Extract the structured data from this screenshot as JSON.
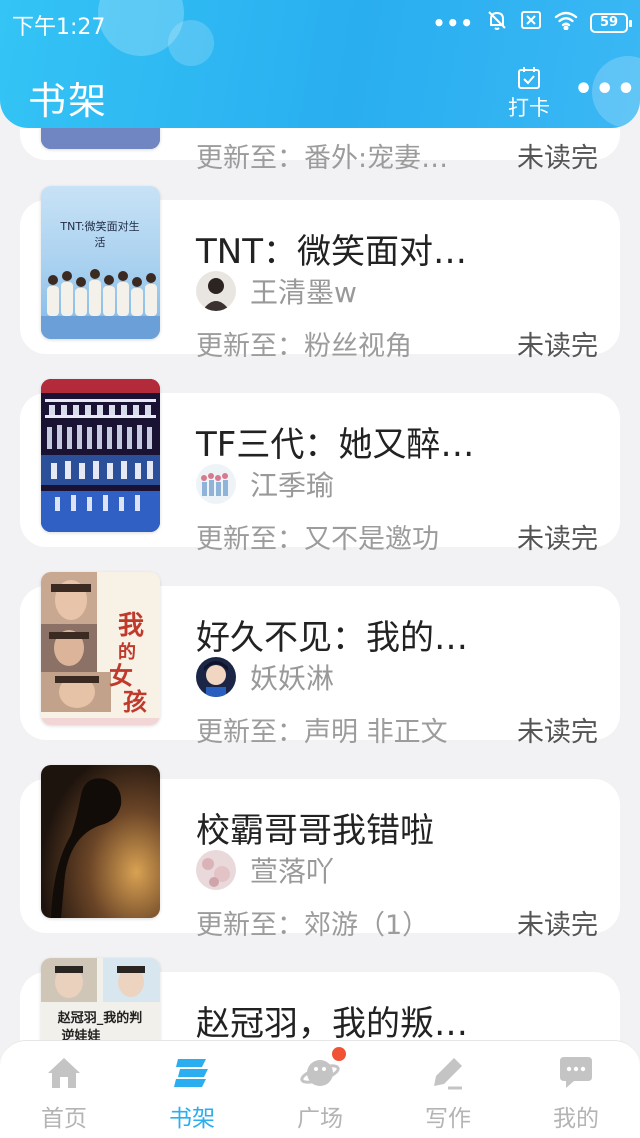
{
  "status_bar": {
    "time": "下午1:27",
    "more_dots": "•••",
    "battery": "59"
  },
  "header": {
    "title": "书架",
    "checkin_label": "打卡",
    "more_label": "•••"
  },
  "books": [
    {
      "title": "",
      "author": "",
      "update": "更新至：番外:宠妻…",
      "status": "未读完"
    },
    {
      "title": "TNT：微笑面对…",
      "cover_text": "TNT:微笑面对生活",
      "author": "王清墨w",
      "update": "更新至：粉丝视角",
      "status": "未读完"
    },
    {
      "title": "TF三代：她又醉…",
      "author": "江季瑜",
      "update": "更新至：又不是邀功",
      "status": "未读完"
    },
    {
      "title": "好久不见：我的…",
      "cover_text": "我的女孩",
      "author": "妖妖淋",
      "update": "更新至：声明  非正文",
      "status": "未读完"
    },
    {
      "title": "校霸哥哥我错啦",
      "author": "萱落吖",
      "update": "更新至：郊游（1）",
      "status": "未读完"
    },
    {
      "title": "赵冠羽，我的叛…",
      "cover_text": "赵冠羽_我的判",
      "author": "",
      "update": "",
      "status": ""
    }
  ],
  "bottom_nav": [
    {
      "label": "首页",
      "icon": "home-icon",
      "active": false
    },
    {
      "label": "书架",
      "icon": "bookshelf-icon",
      "active": true
    },
    {
      "label": "广场",
      "icon": "planet-icon",
      "active": false,
      "badge": true
    },
    {
      "label": "写作",
      "icon": "pen-icon",
      "active": false
    },
    {
      "label": "我的",
      "icon": "chat-bubble-icon",
      "active": false
    }
  ],
  "colors": {
    "header_blue": "#2aaef0",
    "active_nav": "#2aaef0",
    "inactive_nav": "#b4b4b4",
    "badge_red": "#ef5234"
  }
}
